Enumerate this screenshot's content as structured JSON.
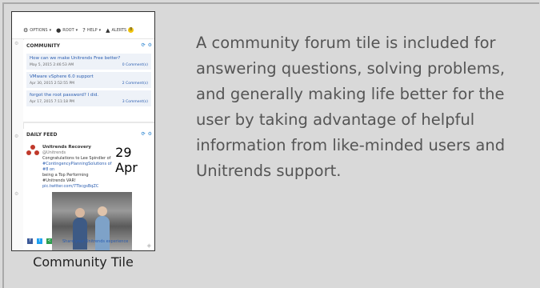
{
  "screenshot": {
    "topbar": {
      "options_label": "OPTIONS",
      "host_label": "ROOT",
      "help_label": "HELP",
      "alerts_label": "ALERTS",
      "alerts_count": "8"
    },
    "community": {
      "title": "COMMUNITY",
      "posts": [
        {
          "question": "How can we make Unitrends Free better?",
          "date": "May 5, 2015 2:46:53 AM",
          "comments": "0 Comment(s)"
        },
        {
          "question": "VMware vSphere 6.0 support",
          "date": "Apr 30, 2015 2:52:55 PM",
          "comments": "2 Comment(s)"
        },
        {
          "question": "forgot the root password? I did.",
          "date": "Apr 17, 2015 7:11:18 PM",
          "comments": "3 Comment(s)"
        }
      ]
    },
    "daily_feed": {
      "title": "DAILY FEED",
      "tweet_author": "Unitrends Recovery",
      "tweet_handle": "@Unitrends",
      "tweet_date": "29 Apr",
      "tweet_line1": "Congratulations to Lee Spindler of",
      "tweet_line2": "#ContingencyPlanningSolutions of #8 on",
      "tweet_line3": "being a Top Performing #Unitrends VAR!",
      "tweet_link": "pic.twitter.com/7TbcgsBqZC",
      "share_text": "Share your Unitrends experience"
    }
  },
  "caption": "Community Tile",
  "description": "A community forum tile is included for answering questions, solving problems, and generally making life better for the user by taking advantage of helpful information from like-minded users and Unitrends support."
}
